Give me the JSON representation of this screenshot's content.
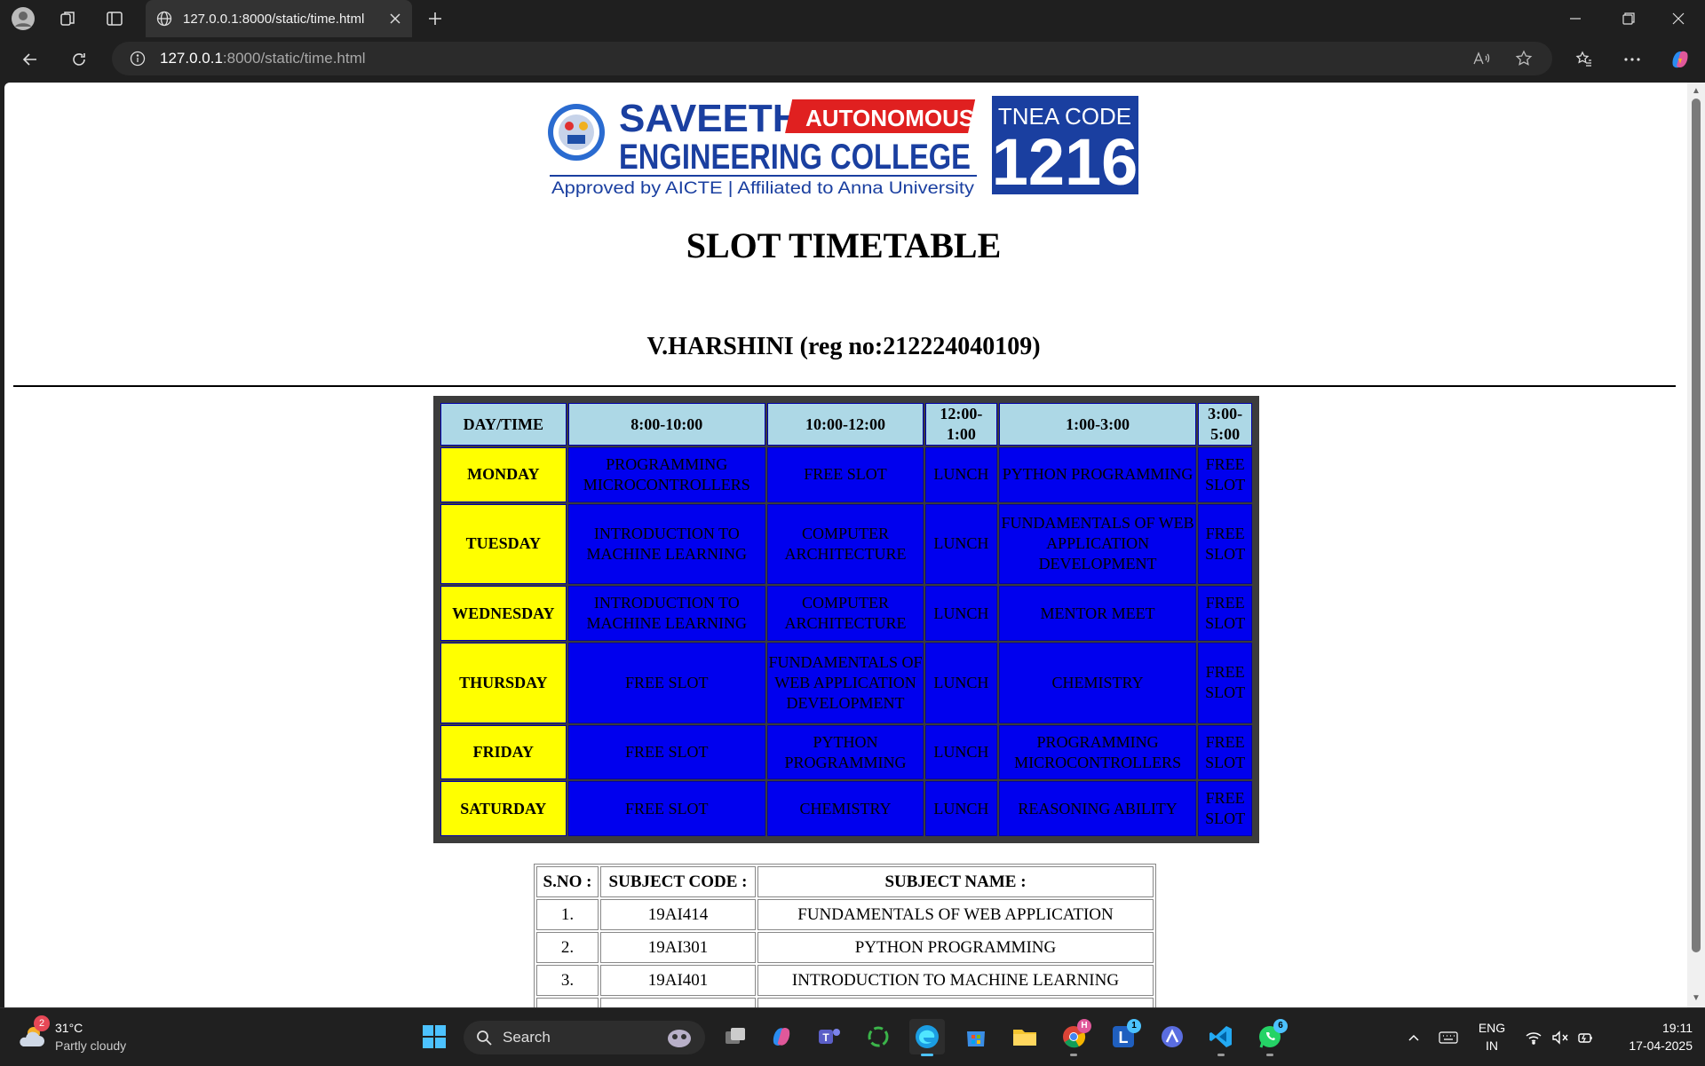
{
  "browser": {
    "tab_title": "127.0.0.1:8000/static/time.html",
    "url_host": "127.0.0.1",
    "url_rest": ":8000/static/time.html"
  },
  "logo": {
    "college_line1": "SAVEETHA",
    "college_line2": "ENGINEERING COLLEGE",
    "autonomous": "AUTONOMOUS",
    "approval": "Approved by AICTE  |  Affiliated to Anna University",
    "tnea_label": "TNEA CODE",
    "tnea_code": "1216",
    "colors": {
      "blue": "#1a3fa0",
      "red": "#e02020"
    }
  },
  "page": {
    "title": "SLOT TIMETABLE",
    "student": "V.HARSHINI (reg no:212224040109)"
  },
  "timetable": {
    "headers": [
      "DAY/TIME",
      "8:00-10:00",
      "10:00-12:00",
      "12:00-1:00",
      "1:00-3:00",
      "3:00-5:00"
    ],
    "rows": [
      {
        "day": "MONDAY",
        "cells": [
          "PROGRAMMING MICROCONTROLLERS",
          "FREE SLOT",
          "LUNCH",
          "PYTHON PROGRAMMING",
          "FREE SLOT"
        ]
      },
      {
        "day": "TUESDAY",
        "cells": [
          "INTRODUCTION TO MACHINE LEARNING",
          "COMPUTER ARCHITECTURE",
          "LUNCH",
          "FUNDAMENTALS OF WEB APPLICATION DEVELOPMENT",
          "FREE SLOT"
        ]
      },
      {
        "day": "WEDNESDAY",
        "cells": [
          "INTRODUCTION TO MACHINE LEARNING",
          "COMPUTER ARCHITECTURE",
          "LUNCH",
          "MENTOR MEET",
          "FREE SLOT"
        ]
      },
      {
        "day": "THURSDAY",
        "cells": [
          "FREE SLOT",
          "FUNDAMENTALS OF WEB APPLICATION DEVELOPMENT",
          "LUNCH",
          "CHEMISTRY",
          "FREE SLOT"
        ]
      },
      {
        "day": "FRIDAY",
        "cells": [
          "FREE SLOT",
          "PYTHON PROGRAMMING",
          "LUNCH",
          "PROGRAMMING MICROCONTROLLERS",
          "FREE SLOT"
        ]
      },
      {
        "day": "SATURDAY",
        "cells": [
          "FREE SLOT",
          "CHEMISTRY",
          "LUNCH",
          "REASONING ABILITY",
          "FREE SLOT"
        ]
      }
    ],
    "colors": {
      "header": "#add8e6",
      "day": "#ffff00",
      "cell": "#0000ee"
    }
  },
  "subjects": {
    "headers": [
      "S.NO :",
      "SUBJECT CODE :",
      "SUBJECT NAME :"
    ],
    "rows": [
      {
        "sno": "1.",
        "code": "19AI414",
        "name": "FUNDAMENTALS OF WEB APPLICATION"
      },
      {
        "sno": "2.",
        "code": "19AI301",
        "name": "PYTHON PROGRAMMING"
      },
      {
        "sno": "3.",
        "code": "19AI401",
        "name": "INTRODUCTION TO MACHINE LEARNING"
      },
      {
        "sno": "",
        "code": "",
        "name": ""
      }
    ]
  },
  "taskbar": {
    "weather_temp": "31°C",
    "weather_desc": "Partly cloudy",
    "weather_badge": "2",
    "search_placeholder": "Search",
    "lang1": "ENG",
    "lang2": "IN",
    "time": "19:11",
    "date": "17-04-2025",
    "chrome_badge": "H",
    "l_badge": "1",
    "whatsapp_badge": "6"
  }
}
